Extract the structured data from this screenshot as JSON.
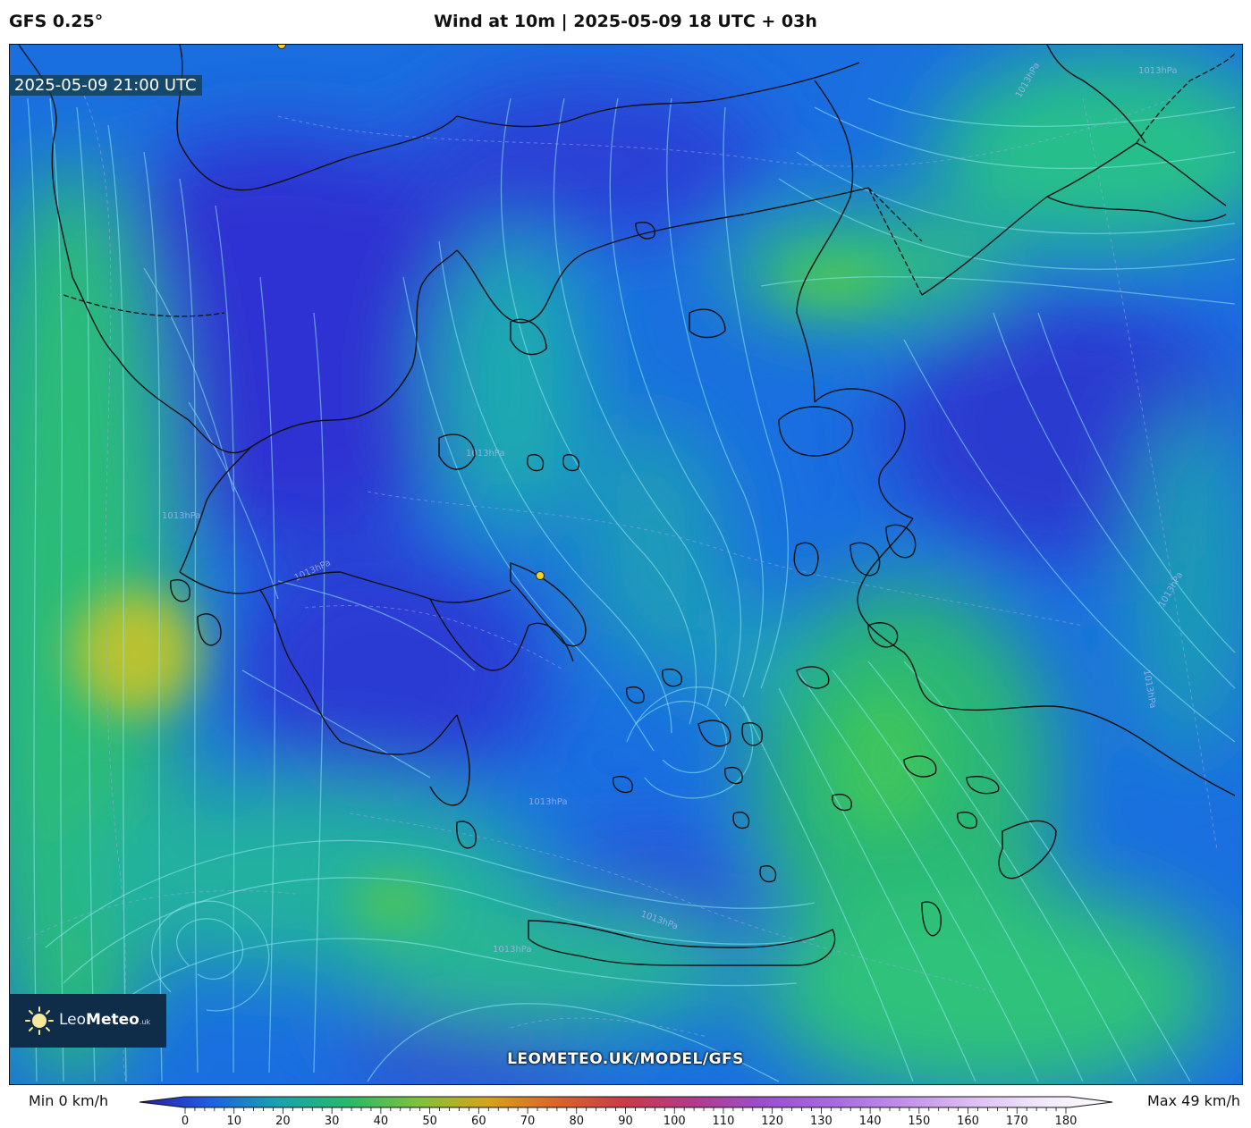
{
  "header": {
    "model": "GFS 0.25°",
    "title": "Wind at 10m | 2025-05-09 18 UTC + 03h"
  },
  "map": {
    "timestamp": "2025-05-09 21:00 UTC",
    "isobar_labels": [
      "1013hPa",
      "1013hPa",
      "1013hPa",
      "1013hPa",
      "1013hPa",
      "1013hPa",
      "1013hPa",
      "1013hPa",
      "1013hPa",
      "1013hPa"
    ],
    "colors": {
      "calm": "#2f2fd6",
      "light": "#1a6fe0",
      "moderate": "#1fb6a0",
      "fresh": "#34c96f",
      "strong": "#b9c435",
      "coastline": "#111111",
      "streamline": "#8fe8f0"
    }
  },
  "branding": {
    "logo_text_regular": "Leo",
    "logo_text_bold": "Meteo",
    "logo_suffix": ".uk",
    "watermark": "LEOMETEO.UK/MODEL/GFS"
  },
  "colorbar": {
    "min_label": "Min 0 km/h",
    "max_label": "Max 49 km/h",
    "ticks": [
      "0",
      "10",
      "20",
      "30",
      "40",
      "50",
      "60",
      "70",
      "80",
      "90",
      "100",
      "110",
      "120",
      "130",
      "140",
      "150",
      "160",
      "170",
      "180"
    ],
    "stops": [
      "#2a1aa8",
      "#1e5fe0",
      "#18a3b0",
      "#28b86a",
      "#7cc23c",
      "#d7a21c",
      "#d9652a",
      "#c83a4a",
      "#b13a8e",
      "#9b4fd0",
      "#a66be0",
      "#c090ea",
      "#dcc0f2",
      "#f2e8fa",
      "#ffffff"
    ]
  }
}
